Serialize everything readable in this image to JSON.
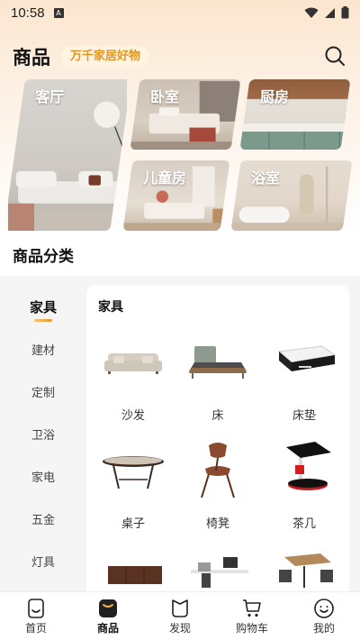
{
  "status_bar": {
    "time": "10:58",
    "sim_label": "A"
  },
  "header": {
    "title": "商品",
    "slogan": "万千家居好物"
  },
  "rooms": [
    {
      "label": "客厅",
      "icon": "living-room-photo"
    },
    {
      "label": "卧室",
      "icon": "bedroom-photo"
    },
    {
      "label": "厨房",
      "icon": "kitchen-photo"
    },
    {
      "label": "儿童房",
      "icon": "kids-room-photo"
    },
    {
      "label": "浴室",
      "icon": "bathroom-photo"
    }
  ],
  "category_section": {
    "title": "商品分类"
  },
  "side_nav": {
    "items": [
      {
        "label": "家具"
      },
      {
        "label": "建材"
      },
      {
        "label": "定制"
      },
      {
        "label": "卫浴"
      },
      {
        "label": "家电"
      },
      {
        "label": "五金"
      },
      {
        "label": "灯具"
      }
    ],
    "active": "家具"
  },
  "panel": {
    "title": "家具",
    "products": [
      {
        "name": "沙发",
        "icon": "sofa-image"
      },
      {
        "name": "床",
        "icon": "bed-image"
      },
      {
        "name": "床垫",
        "icon": "mattress-image"
      },
      {
        "name": "桌子",
        "icon": "table-image"
      },
      {
        "name": "椅凳",
        "icon": "chair-image"
      },
      {
        "name": "茶几",
        "icon": "side-table-image"
      },
      {
        "name": "",
        "icon": "sideboard-image"
      },
      {
        "name": "",
        "icon": "desk-image"
      },
      {
        "name": "",
        "icon": "dining-set-image"
      }
    ]
  },
  "tabs": [
    {
      "label": "首页",
      "icon": "home-face-icon"
    },
    {
      "label": "商品",
      "icon": "goods-icon"
    },
    {
      "label": "发现",
      "icon": "discover-icon"
    },
    {
      "label": "购物车",
      "icon": "cart-icon"
    },
    {
      "label": "我的",
      "icon": "profile-icon"
    }
  ],
  "colors": {
    "accent": "#e89a2c",
    "badge_bg": "#fff3e2",
    "badge_text": "#e0961e"
  }
}
